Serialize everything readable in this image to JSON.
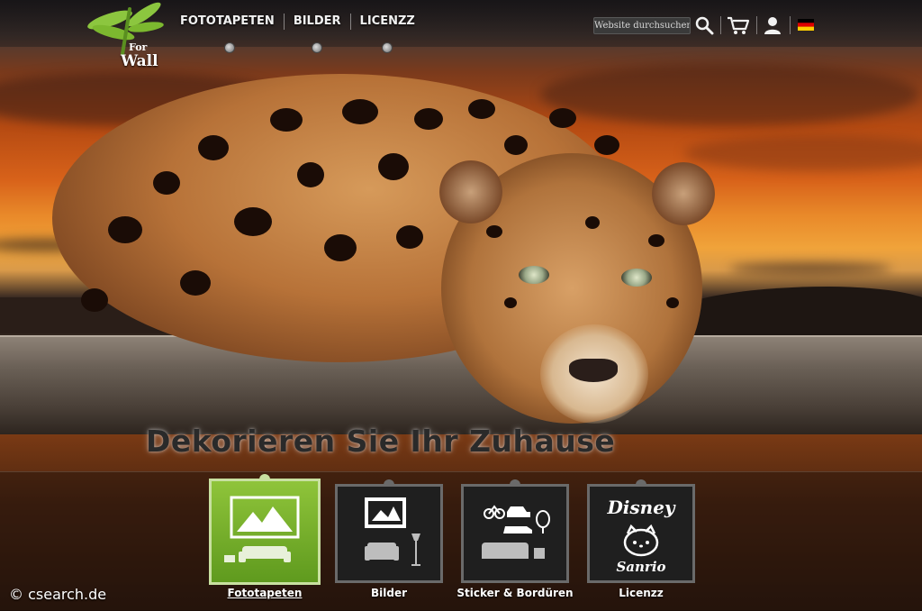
{
  "header": {
    "logo_text_small": "For",
    "logo_text_large": "Wall",
    "nav": [
      {
        "label": "FOTOTAPETEN"
      },
      {
        "label": "BILDER"
      },
      {
        "label": "LICENZZ"
      }
    ],
    "search_placeholder": "Website durchsuchen",
    "icons": [
      "search-icon",
      "cart-icon",
      "user-icon",
      "german-flag-icon"
    ]
  },
  "hero": {
    "headline": "Dekorieren Sie Ihr Zuhause"
  },
  "categories": [
    {
      "label": "Fototapeten",
      "icon": "mountain-sofa-icon",
      "active": true
    },
    {
      "label": "Bilder",
      "icon": "picture-armchair-icon",
      "active": false
    },
    {
      "label": "Sticker & Bordüren",
      "icon": "stickers-sofa-icon",
      "active": false
    },
    {
      "label": "Licenzz",
      "icon": "disney-sanrio-icon",
      "active": false,
      "brands": [
        "Disney",
        "Sanrio"
      ]
    }
  ],
  "footer": {
    "watermark": "© csearch.de"
  },
  "colors": {
    "accent_green": "#7cb82f",
    "sky_orange": "#e98a2a",
    "tile_dark": "#1f1f1f"
  }
}
